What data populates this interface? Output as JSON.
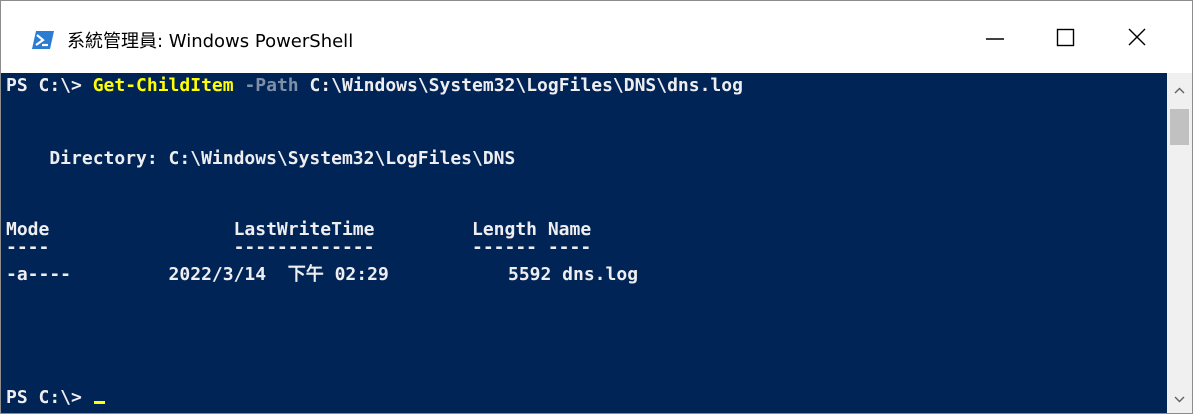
{
  "window": {
    "title": "系統管理員: Windows PowerShell",
    "icon": "powershell-icon",
    "controls": [
      "minimize-icon",
      "maximize-icon",
      "close-icon"
    ]
  },
  "console": {
    "prompt1": "PS C:\\> ",
    "cmdlet": "Get-ChildItem",
    "param": "-Path",
    "path_arg": "C:\\Windows\\System32\\LogFiles\\DNS\\dns.log",
    "directory_line": "    Directory: C:\\Windows\\System32\\LogFiles\\DNS",
    "header_line": "Mode                 LastWriteTime         Length Name",
    "underline_line": "----                 -------------         ------ ----",
    "row_line": "-a----         2022/3/14  下午 02:29           5592 dns.log",
    "prompt2": "PS C:\\> "
  },
  "colors": {
    "console_bg": "#012456",
    "console_text": "#eeedf0",
    "cmdlet": "#ffff00",
    "parameter": "#7f8fa6"
  }
}
